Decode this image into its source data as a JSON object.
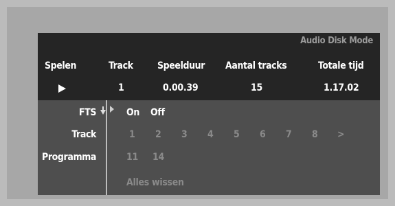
{
  "title": "Audio Disk Mode",
  "status": {
    "headers": [
      "Spelen",
      "Track",
      "Speelduur",
      "Aantal tracks",
      "Totale tijd"
    ],
    "track": "1",
    "speelduur": "0.00.39",
    "aantal_tracks": "15",
    "totale_tijd": "1.17.02"
  },
  "fts": {
    "label": "FTS",
    "options": [
      "On",
      "Off"
    ]
  },
  "track": {
    "label": "Track",
    "numbers": [
      "1",
      "2",
      "3",
      "4",
      "5",
      "6",
      "7",
      "8",
      ">"
    ]
  },
  "programma": {
    "label": "Programma",
    "entries": [
      "11",
      "14"
    ]
  },
  "clear_all": "Alles wissen",
  "icons": {
    "play": "play-icon",
    "cursor": "down-arrow-cursor-icon",
    "selector": "right-triangle-icon"
  }
}
